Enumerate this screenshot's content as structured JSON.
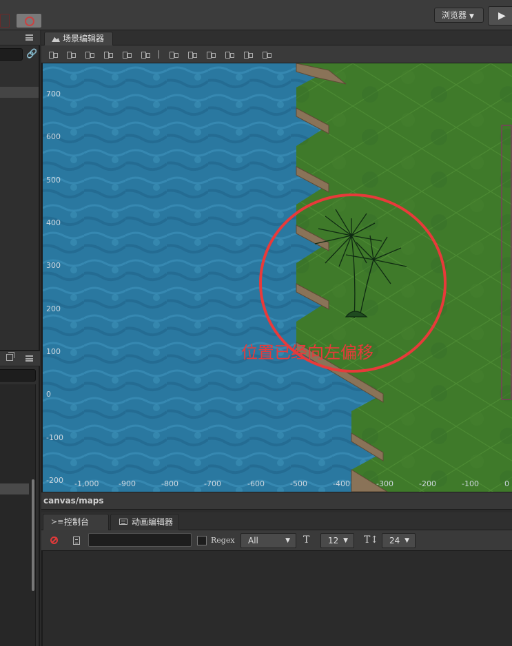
{
  "top_bar": {
    "browser_label": "浏览器",
    "browser_caret": "▼",
    "play_glyph": "▶"
  },
  "left_panel": {
    "menu_icon": "menu-icon",
    "link_icon": "link-icon",
    "restore_icon": "restore-icon"
  },
  "scene_editor": {
    "tab_label": "场景编辑器",
    "tab_icon": "scene-icon",
    "align_tools": [
      "align-top",
      "align-vcenter",
      "align-bottom",
      "align-left",
      "align-hcenter",
      "align-right",
      "distribute-top",
      "distribute-vcenter",
      "distribute-bottom",
      "distribute-left",
      "distribute-hcenter",
      "distribute-right"
    ],
    "y_ticks": [
      "700",
      "600",
      "500",
      "400",
      "300",
      "200",
      "100",
      "0",
      "-100",
      "-200"
    ],
    "x_ticks": [
      "-1,000",
      "-900",
      "-800",
      "-700",
      "-600",
      "-500",
      "-400",
      "-300",
      "-200",
      "-100",
      "0"
    ],
    "annotation": "位置已经向左偏移",
    "colors": {
      "water": "#2a78a0",
      "grass": "#3f7a2a",
      "cliff": "#8a7358",
      "annotation": "#e83a3a",
      "selection": "#8a2f6a"
    }
  },
  "path_bar": {
    "path": "canvas/maps"
  },
  "console": {
    "tab_console": "控制台",
    "tab_console_glyph": "≻≡",
    "tab_animation": "动画编辑器",
    "search_value": "",
    "regex_label": "Regex",
    "log_level": "All",
    "font_size": "12",
    "line_height": "24",
    "font_size_glyph": "T",
    "line_height_glyph": "T↕",
    "caret": "▼"
  }
}
